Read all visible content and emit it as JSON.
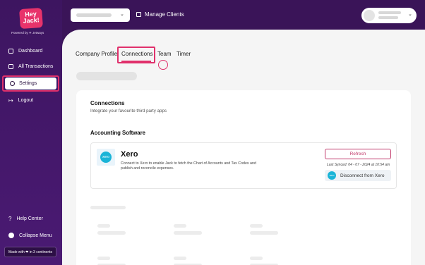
{
  "brand": {
    "logo_line1": "Hey",
    "logo_line2": "Jack!",
    "powered_by": "Powered by ✈ Jetways"
  },
  "sidebar": {
    "items": [
      {
        "label": "Dashboard",
        "icon": "grid-icon"
      },
      {
        "label": "All Transactions",
        "icon": "transactions-icon"
      },
      {
        "label": "Settings",
        "icon": "gear-icon"
      },
      {
        "label": "Logout",
        "icon": "logout-icon"
      }
    ],
    "help": {
      "label": "Help Center",
      "icon": "question-icon"
    },
    "collapse": {
      "label": "Collapse Menu",
      "icon": "collapse-icon"
    },
    "made_with": "Made with ❤ in 3 continents"
  },
  "topbar": {
    "manage_clients": "Manage Clients"
  },
  "tabs": [
    {
      "label": "Company Profile"
    },
    {
      "label": "Connections",
      "active": true
    },
    {
      "label": "Team"
    },
    {
      "label": "Timer"
    }
  ],
  "connections": {
    "title": "Connections",
    "subtitle": "Integrate your favourite third party apps",
    "accounting_title": "Accounting Software",
    "xero": {
      "logo_text": "xero",
      "name": "Xero",
      "description": "Connect to Xero to enable Jack to fetch the Chart of Accounts and Tax Codes and publish and reconcile expenses.",
      "refresh_label": "Refresh",
      "last_synced": "Last Synced: 04 - 07 - 2024 at 10:54 am",
      "disconnect_label": "Disconnect from Xero"
    }
  },
  "colors": {
    "sidebar_bg": "#3d1560",
    "accent": "#e0306b",
    "brand_pink": "#e8336b",
    "xero_blue": "#1ab4d7"
  }
}
